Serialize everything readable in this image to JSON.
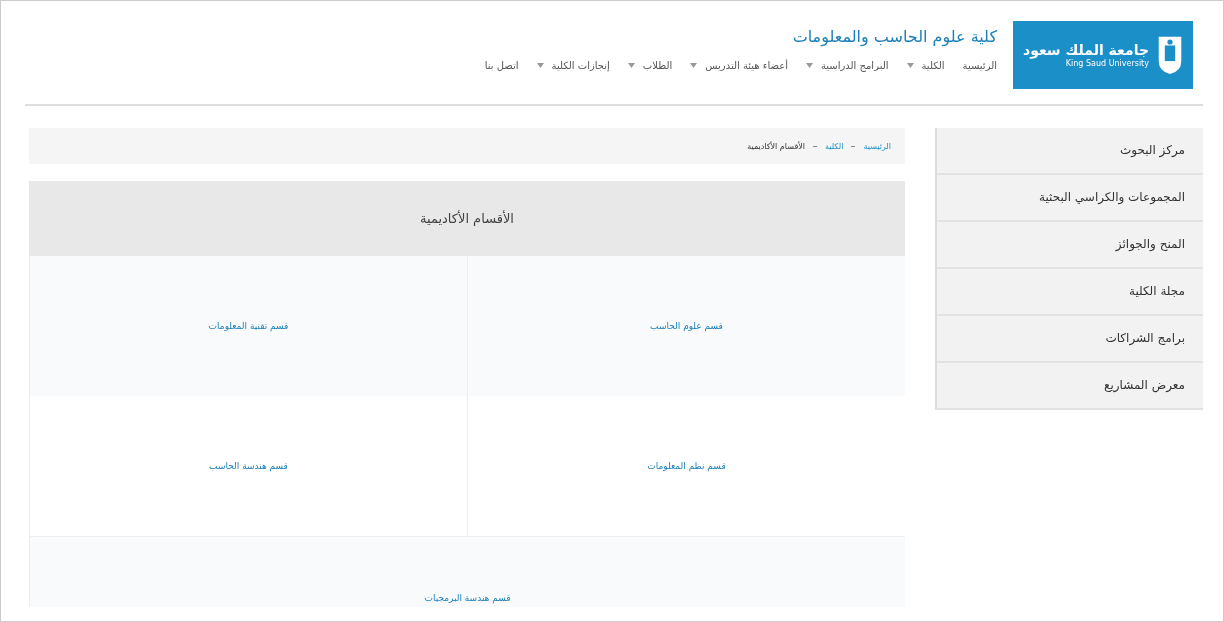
{
  "logo": {
    "arabic": "جامعة الملك سعود",
    "english": "King Saud University"
  },
  "site_title": "كلية علوم الحاسب والمعلومات",
  "nav": [
    {
      "label": "الرئيسية",
      "dropdown": false
    },
    {
      "label": "الكلية",
      "dropdown": true
    },
    {
      "label": "البرامج الدراسية",
      "dropdown": true
    },
    {
      "label": "أعضاء هيئة التدريس",
      "dropdown": true
    },
    {
      "label": "الطلاب",
      "dropdown": true
    },
    {
      "label": "إنجازات الكلية",
      "dropdown": true
    },
    {
      "label": "اتصل بنا",
      "dropdown": false
    }
  ],
  "sidebar": {
    "items": [
      "مركز البحوث",
      "المجموعات والكراسي البحثية",
      "المنح والجوائز",
      "مجلة الكلية",
      "برامج الشراكات",
      "معرض المشاريع"
    ]
  },
  "breadcrumb": [
    {
      "label": "الرئيسية",
      "current": false
    },
    {
      "label": "الكلية",
      "current": false
    },
    {
      "label": "الأقسام الأكاديمية",
      "current": true
    }
  ],
  "departments": {
    "heading": "الأقسام الأكاديمية",
    "items": [
      "قسم علوم الحاسب",
      "قسم تقنية المعلومات",
      "قسم نظم المعلومات",
      "قسم هندسة الحاسب",
      "قسم هندسة البرمجيات"
    ]
  }
}
